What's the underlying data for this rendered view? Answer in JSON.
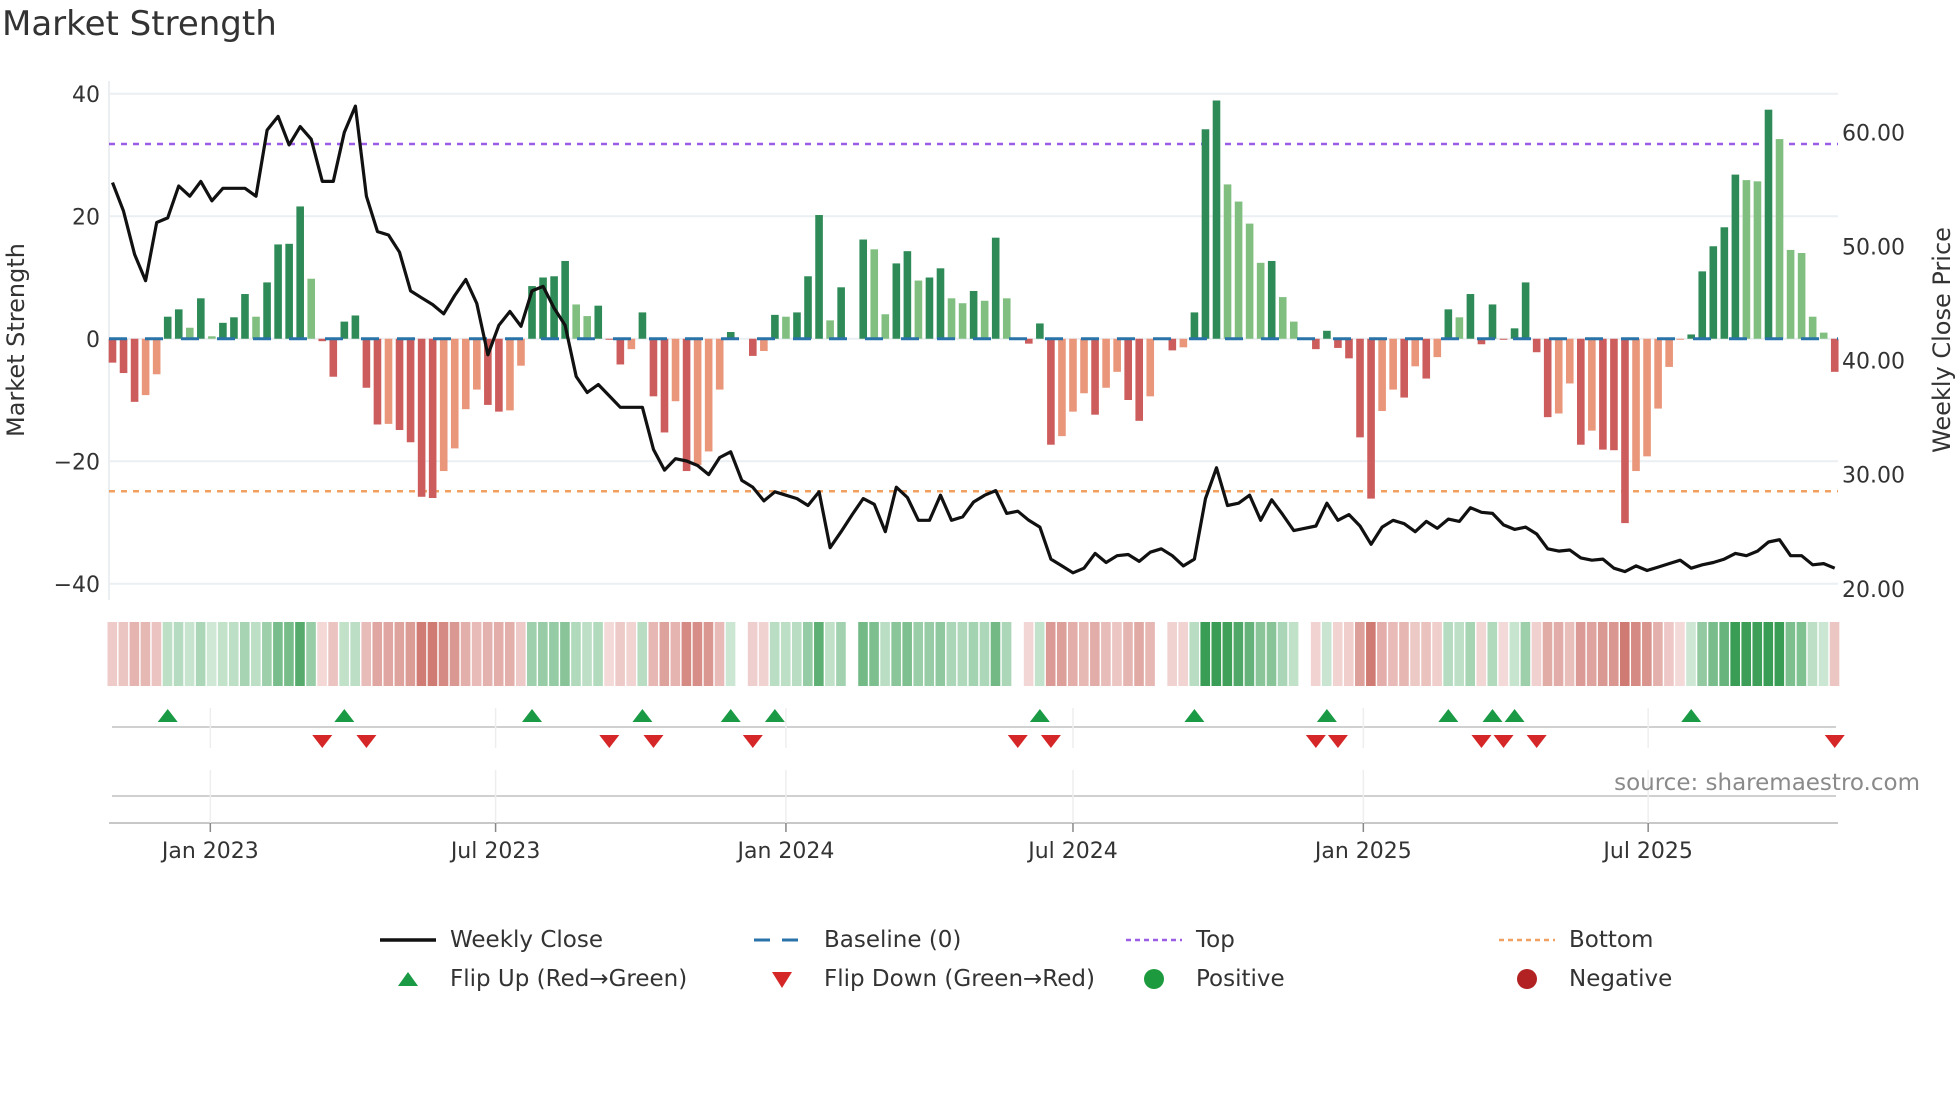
{
  "title": "Market Strength",
  "source": "source: sharemaestro.com",
  "colors": {
    "close": "#111111",
    "baseline": "#2a73a8",
    "top": "#9b5de5",
    "bottom": "#f0a060",
    "bar_pos_dark": "#2e8b57",
    "bar_pos_light": "#80bf80",
    "bar_neg_dark": "#cd5c5c",
    "bar_neg_light": "#e9967a",
    "flip_up": "#1a9a45",
    "flip_down": "#d62728",
    "positive": "#1e9a3e",
    "negative": "#b22222"
  },
  "legend": [
    {
      "label": "Weekly Close",
      "symbol": "line"
    },
    {
      "label": "Baseline (0)",
      "symbol": "dash"
    },
    {
      "label": "Top",
      "symbol": "dot-purple"
    },
    {
      "label": "Bottom",
      "symbol": "dot-orange"
    },
    {
      "label": "Flip Up (Red→Green)",
      "symbol": "triangle-up"
    },
    {
      "label": "Flip Down (Green→Red)",
      "symbol": "triangle-down"
    },
    {
      "label": "Positive",
      "symbol": "circle-green"
    },
    {
      "label": "Negative",
      "symbol": "circle-red"
    }
  ],
  "chart_data": {
    "type": "bar",
    "title": "Market Strength",
    "frequency": "weekly",
    "ylabel": "Market Strength",
    "ylabel_right": "Weekly Close Price",
    "ylim": [
      -42,
      42
    ],
    "ylim_right": [
      19,
      64
    ],
    "yticks": [
      "40",
      "20",
      "0",
      "−20",
      "−40"
    ],
    "ytick_values": [
      40,
      20,
      0,
      -20,
      -40
    ],
    "yticks_right": [
      "60.00",
      "50.00",
      "40.00",
      "30.00",
      "20.00"
    ],
    "ytick_right_values": [
      60,
      50,
      40,
      30,
      20
    ],
    "xticks": [
      {
        "label": "Jan 2023",
        "week": 8.86
      },
      {
        "label": "Jul 2023",
        "week": 34.7
      },
      {
        "label": "Jan 2024",
        "week": 61.0
      },
      {
        "label": "Jul 2024",
        "week": 87.0
      },
      {
        "label": "Jan 2025",
        "week": 113.3
      },
      {
        "label": "Jul 2025",
        "week": 139.1
      }
    ],
    "top_level": 31.8,
    "bottom_level": -24.9,
    "baseline": 0,
    "strength": [
      -3.9,
      -5.6,
      -10.3,
      -9.2,
      -5.8,
      3.6,
      4.8,
      1.8,
      6.6,
      0.4,
      2.6,
      3.5,
      7.3,
      3.6,
      9.2,
      15.4,
      15.5,
      21.6,
      9.8,
      -0.4,
      -6.2,
      2.8,
      3.8,
      -8,
      -14,
      -13.9,
      -14.9,
      -16.9,
      -25.8,
      -26,
      -21.6,
      -17.9,
      -11.5,
      -8.3,
      -10.8,
      -11.9,
      -11.7,
      -4.4,
      8.6,
      10,
      10.2,
      12.7,
      5.6,
      3.7,
      5.4,
      -0.1,
      -4.2,
      -1.7,
      4.3,
      -9.4,
      -15.3,
      -10.2,
      -21.6,
      -20.6,
      -18.4,
      -8.3,
      1.1,
      0,
      -2.8,
      -2,
      3.9,
      3.6,
      4.3,
      10.2,
      20.2,
      3,
      8.4,
      0,
      16.2,
      14.6,
      4,
      12.3,
      14.3,
      9.5,
      10,
      11.5,
      6.6,
      5.8,
      7.8,
      6.2,
      16.5,
      6.6,
      0,
      -0.8,
      2.5,
      -17.3,
      -15.9,
      -11.9,
      -8.9,
      -12.4,
      -8,
      -5.4,
      -10,
      -13.4,
      -9.4,
      0,
      -1.9,
      -1.4,
      4.3,
      34.2,
      38.9,
      25.2,
      22.4,
      18.8,
      12.4,
      12.7,
      6.8,
      2.8,
      0,
      -1.7,
      1.3,
      -1.5,
      -3.2,
      -16.1,
      -26.1,
      -11.8,
      -8.3,
      -9.6,
      -4.5,
      -6.5,
      -3,
      4.8,
      3.5,
      7.3,
      -0.9,
      5.6,
      -0.1,
      1.7,
      9.2,
      -2.2,
      -12.8,
      -12.2,
      -7.3,
      -17.3,
      -15,
      -18.1,
      -18.2,
      -30.1,
      -21.6,
      -19.2,
      -11.4,
      -4.6,
      -0.1,
      0.7,
      11,
      15.1,
      18.2,
      26.8,
      25.9,
      25.7,
      37.4,
      32.6,
      14.5,
      14,
      3.6,
      1,
      -5.4
    ],
    "weekly_close": [
      55.6,
      53.1,
      49.3,
      47,
      52.1,
      52.5,
      55.3,
      54.4,
      55.7,
      54,
      55.1,
      55.1,
      55.1,
      54.4,
      60.2,
      61.4,
      58.9,
      60.5,
      59.4,
      55.7,
      55.7,
      60,
      62.3,
      54.4,
      51.3,
      51,
      49.5,
      46.1,
      45.5,
      44.9,
      44.1,
      45.7,
      47.1,
      45,
      40.5,
      43.1,
      44.3,
      43,
      46.1,
      46.5,
      44.6,
      43.1,
      38.6,
      37.2,
      37.9,
      36.9,
      35.9,
      35.9,
      35.9,
      32.2,
      30.4,
      31.4,
      31.2,
      30.8,
      30,
      31.5,
      32,
      29.5,
      28.9,
      27.7,
      28.5,
      28.2,
      27.9,
      27.3,
      28.5,
      23.6,
      25,
      26.5,
      27.9,
      27.4,
      25,
      28.9,
      28,
      26,
      26,
      28.2,
      26,
      26.3,
      27.6,
      28.2,
      28.6,
      26.6,
      26.8,
      26,
      25.4,
      22.6,
      22,
      21.4,
      21.8,
      23.1,
      22.3,
      22.9,
      23,
      22.4,
      23.2,
      23.5,
      22.9,
      22,
      22.6,
      27.9,
      30.6,
      27.3,
      27.5,
      28.2,
      26,
      27.8,
      26.5,
      25.1,
      25.3,
      25.5,
      27.5,
      26,
      26.5,
      25.5,
      23.9,
      25.4,
      26,
      25.7,
      25,
      25.9,
      25.3,
      26.1,
      25.9,
      27.1,
      26.7,
      26.6,
      25.6,
      25.2,
      25.4,
      24.8,
      23.5,
      23.3,
      23.4,
      22.7,
      22.5,
      22.6,
      21.8,
      21.5,
      22,
      21.6,
      21.9,
      22.2,
      22.5,
      21.8,
      22.1,
      22.3,
      22.6,
      23.1,
      22.9,
      23.3,
      24.1,
      24.3,
      22.9,
      22.9,
      22.1,
      22.2,
      21.8
    ],
    "flip_up_weeks": [
      5,
      21,
      38,
      48,
      56,
      60,
      84,
      98,
      110,
      121,
      125,
      127,
      143
    ],
    "flip_down_weeks": [
      19,
      23,
      45,
      49,
      58,
      82,
      85,
      109,
      111,
      124,
      126,
      129,
      156
    ],
    "legend_position": "bottom"
  }
}
